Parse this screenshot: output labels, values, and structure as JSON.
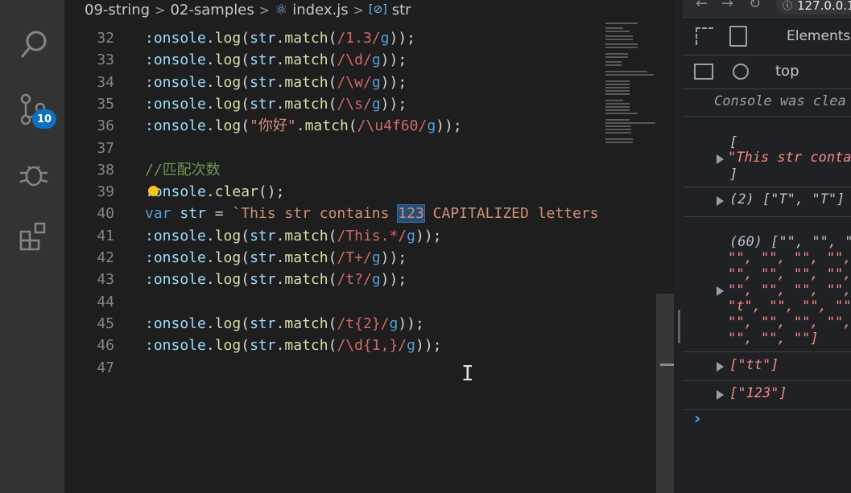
{
  "editor": {
    "breadcrumb": [
      "09-string",
      "02-samples",
      "index.js",
      "str"
    ],
    "lines": [
      {
        "n": "32",
        "html": "<span class='vr'>:onsole</span>.<span class='fn'>log</span>(<span class='vr'>str</span>.<span class='fn'>match</span>(<span class='rx'>/1.3/</span><span class='kw'>g</span>));"
      },
      {
        "n": "33",
        "html": "<span class='vr'>:onsole</span>.<span class='fn'>log</span>(<span class='vr'>str</span>.<span class='fn'>match</span>(<span class='rx'>/\\d/</span><span class='kw'>g</span>));"
      },
      {
        "n": "34",
        "html": "<span class='vr'>:onsole</span>.<span class='fn'>log</span>(<span class='vr'>str</span>.<span class='fn'>match</span>(<span class='rx'>/\\w/</span><span class='kw'>g</span>));"
      },
      {
        "n": "35",
        "html": "<span class='vr'>:onsole</span>.<span class='fn'>log</span>(<span class='vr'>str</span>.<span class='fn'>match</span>(<span class='rx'>/\\s/</span><span class='kw'>g</span>));"
      },
      {
        "n": "36",
        "html": "<span class='vr'>:onsole</span>.<span class='fn'>log</span>(<span class='st'>\"你好\"</span>.<span class='fn'>match</span>(<span class='rx'>/\\u4f60/</span><span class='kw'>g</span>));"
      },
      {
        "n": "37",
        "html": ""
      },
      {
        "n": "38",
        "html": "<span class='cm'>//匹配次数</span>"
      },
      {
        "n": "39",
        "html": "<span class='vr'>:onsole</span>.<span class='fn'>clear</span>();"
      },
      {
        "n": "40",
        "html": "<span class='kw'>var</span> <span class='vr'>str</span> = <span class='st'>`This str contains <span class='hl'>123</span> CAPITALIZED letters</span>"
      },
      {
        "n": "41",
        "html": "<span class='vr'>:onsole</span>.<span class='fn'>log</span>(<span class='vr'>str</span>.<span class='fn'>match</span>(<span class='rx'>/This.*/</span><span class='kw'>g</span>));"
      },
      {
        "n": "42",
        "html": "<span class='vr'>:onsole</span>.<span class='fn'>log</span>(<span class='vr'>str</span>.<span class='fn'>match</span>(<span class='rx'>/T+/</span><span class='kw'>g</span>));"
      },
      {
        "n": "43",
        "html": "<span class='vr'>:onsole</span>.<span class='fn'>log</span>(<span class='vr'>str</span>.<span class='fn'>match</span>(<span class='rx'>/t?/</span><span class='kw'>g</span>));"
      },
      {
        "n": "44",
        "html": ""
      },
      {
        "n": "45",
        "html": "<span class='vr'>:onsole</span>.<span class='fn'>log</span>(<span class='vr'>str</span>.<span class='fn'>match</span>(<span class='rx'>/t{2}/</span><span class='kw'>g</span>));"
      },
      {
        "n": "46",
        "html": "<span class='vr'>:onsole</span>.<span class='fn'>log</span>(<span class='vr'>str</span>.<span class='fn'>match</span>(<span class='rx'>/\\d{1,}/</span><span class='kw'>g</span>));"
      },
      {
        "n": "47",
        "html": ""
      }
    ],
    "source_control_badge": "10"
  },
  "devtools": {
    "url": "127.0.0.1",
    "tab": "Elements",
    "context": "top",
    "cleared": "Console was clea",
    "entries": {
      "e1_open": "[",
      "e1_str": "\"This str conta",
      "e1_close": "]",
      "e2": "(2) [\"T\", \"T\"]",
      "e3_head": "(60) [\"\", \"\", \"",
      "e3_rows": [
        "\"\", \"\", \"\", \"\",",
        "\"\", \"\", \"\", \"\",",
        "\"\", \"\", \"\", \"\",",
        "\"t\", \"\", \"\", \"\"",
        "\"\", \"\", \"\", \"\",",
        "\"\", \"\", \"\"]"
      ],
      "e4": "[\"tt\"]",
      "e5": "[\"123\"]"
    },
    "prompt": "›"
  }
}
